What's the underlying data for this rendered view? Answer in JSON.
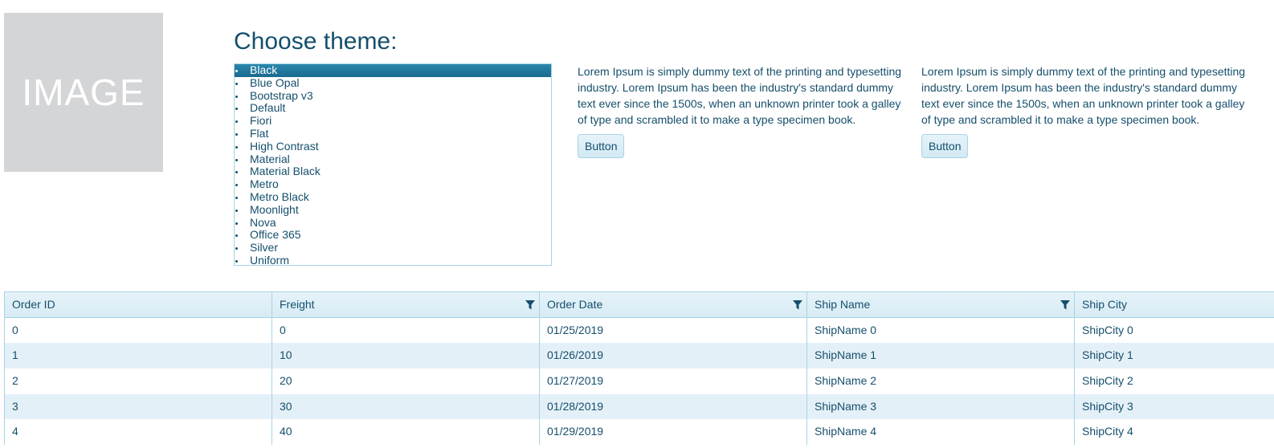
{
  "image_placeholder": {
    "label": "IMAGE"
  },
  "theme_chooser": {
    "title": "Choose theme:",
    "items": [
      "Black",
      "Blue Opal",
      "Bootstrap v3",
      "Default",
      "Fiori",
      "Flat",
      "High Contrast",
      "Material",
      "Material Black",
      "Metro",
      "Metro Black",
      "Moonlight",
      "Nova",
      "Office 365",
      "Silver",
      "Uniform"
    ],
    "selected": "Black"
  },
  "content_blocks": [
    {
      "text": "Lorem Ipsum is simply dummy text of the printing and typesetting industry. Lorem Ipsum has been the industry's standard dummy text ever since the 1500s, when an unknown printer took a galley of type and scrambled it to make a type specimen book.",
      "button_label": "Button"
    },
    {
      "text": "Lorem Ipsum is simply dummy text of the printing and typesetting industry. Lorem Ipsum has been the industry's standard dummy text ever since the 1500s, when an unknown printer took a galley of type and scrambled it to make a type specimen book.",
      "button_label": "Button"
    }
  ],
  "grid": {
    "columns": [
      {
        "label": "Order ID",
        "filter_icon": ""
      },
      {
        "label": "Freight",
        "filter_icon": "filter-icon"
      },
      {
        "label": "Order Date",
        "filter_icon": "filter-icon"
      },
      {
        "label": "Ship Name",
        "filter_icon": "filter-icon"
      },
      {
        "label": "Ship City",
        "filter_icon": ""
      }
    ],
    "rows": [
      [
        "0",
        "0",
        "01/25/2019",
        "ShipName 0",
        "ShipCity 0"
      ],
      [
        "1",
        "10",
        "01/26/2019",
        "ShipName 1",
        "ShipCity 1"
      ],
      [
        "2",
        "20",
        "01/27/2019",
        "ShipName 2",
        "ShipCity 2"
      ],
      [
        "3",
        "30",
        "01/28/2019",
        "ShipName 3",
        "ShipCity 3"
      ],
      [
        "4",
        "40",
        "01/29/2019",
        "ShipName 4",
        "ShipCity 4"
      ]
    ]
  },
  "colors": {
    "text": "#154f6c",
    "border": "#a7d3e6",
    "selected_bg": "#1a6a8e",
    "alt_row_bg": "#e4f0f7",
    "image_bg": "#d4d5d7"
  }
}
